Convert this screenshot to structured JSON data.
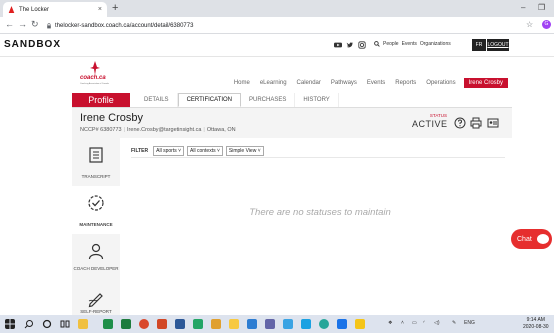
{
  "browser": {
    "tab_title": "The Locker",
    "tab_close": "×",
    "new_tab": "+",
    "minimize": "–",
    "restore": "❐",
    "url": "thelocker-sandbox.coach.ca/account/detail/6380773",
    "profile_initial": "G"
  },
  "topbar": {
    "env_label": "SANDBOX",
    "search_items": [
      "People",
      "Events",
      "Organizations"
    ],
    "lang_button": "FR",
    "logout_button": "LOGOUT"
  },
  "header": {
    "logo_text": "coach.ca",
    "logo_subtext": "Coaching Association of Canada",
    "nav": [
      "Home",
      "eLearning",
      "Calendar",
      "Pathways",
      "Events",
      "Reports",
      "Operations"
    ],
    "user_menu": "Irene Crosby"
  },
  "subnav": {
    "title": "Profile",
    "tabs": [
      "DETAILS",
      "CERTIFICATION",
      "PURCHASES",
      "HISTORY"
    ],
    "active_tab": "CERTIFICATION"
  },
  "profile": {
    "name": "Irene Crosby",
    "nccp": "NCCP# 6380773",
    "email": "Irene.Crosby@targetinsight.ca",
    "location": "Ottawa, ON",
    "status_label": "STATUS",
    "status_value": "ACTIVE"
  },
  "sidebar": {
    "items": [
      {
        "label": "TRANSCRIPT",
        "icon": "document-icon"
      },
      {
        "label": "MAINTENANCE",
        "icon": "check-circle-icon"
      },
      {
        "label": "COACH DEVELOPER",
        "icon": "person-icon"
      },
      {
        "label": "SELF-REPORT",
        "icon": "pen-icon"
      }
    ]
  },
  "filter": {
    "label": "FILTER",
    "options": [
      "All sports",
      "All contexts",
      "Simple View"
    ]
  },
  "main": {
    "empty_message": "There are no statuses to maintain"
  },
  "chat": {
    "label": "Chat"
  },
  "taskbar": {
    "lang": "ENG",
    "time": "9:14 AM",
    "date": "2020-08-30"
  },
  "colors": {
    "brand_red": "#c8102e",
    "chat_red": "#e62e2e"
  }
}
